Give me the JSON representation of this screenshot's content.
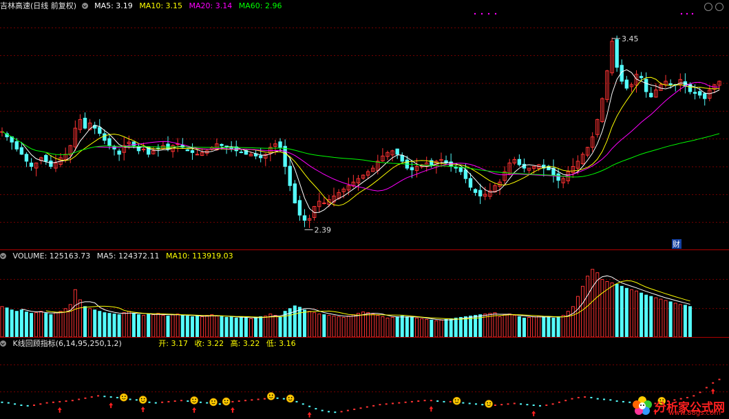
{
  "price_header": {
    "stock": "吉林高速(日线 前复权)",
    "ma5": "MA5: 3.19",
    "ma10": "MA10: 3.15",
    "ma20": "MA20: 3.14",
    "ma60": "MA60: 2.96"
  },
  "volume_header": {
    "volume": "VOLUME: 125163.73",
    "ma5": "MA5: 124372.11",
    "ma10": "MA10: 113919.03"
  },
  "indicator_header": {
    "name": "K线回顾指标(6,14,95,250,1,2)",
    "open": "开: 3.17",
    "close": "收: 3.22",
    "high": "高: 3.22",
    "low": "低: 3.16"
  },
  "price_annotations": {
    "high_label": "3.45",
    "low_label": "2.39",
    "fin_marker": "财"
  },
  "colors": {
    "up": "#ff3333",
    "down": "#54fcfc",
    "ma5": "#ffffff",
    "ma10": "#ffff00",
    "ma20": "#ff00ff",
    "ma60": "#00ff00",
    "grid": "#7a0000"
  },
  "watermark": {
    "text": "分析家公式网",
    "url": "www.88gs.com"
  },
  "chart_data": [
    {
      "type": "candlestick",
      "ylim": [
        2.3,
        3.6
      ],
      "ma_lines": [
        "MA5",
        "MA10",
        "MA20",
        "MA60"
      ],
      "closes": [
        2.93,
        2.9,
        2.87,
        2.83,
        2.8,
        2.76,
        2.73,
        2.75,
        2.78,
        2.76,
        2.73,
        2.75,
        2.78,
        2.8,
        2.85,
        2.95,
        3,
        2.95,
        2.98,
        2.95,
        2.92,
        2.88,
        2.85,
        2.83,
        2.8,
        2.85,
        2.87,
        2.85,
        2.82,
        2.83,
        2.8,
        2.82,
        2.83,
        2.85,
        2.83,
        2.85,
        2.86,
        2.84,
        2.82,
        2.81,
        2.8,
        2.81,
        2.82,
        2.84,
        2.86,
        2.85,
        2.84,
        2.83,
        2.82,
        2.81,
        2.8,
        2.8,
        2.79,
        2.78,
        2.8,
        2.84,
        2.86,
        2.84,
        2.73,
        2.62,
        2.52,
        2.45,
        2.42,
        2.43,
        2.5,
        2.53,
        2.52,
        2.54,
        2.56,
        2.58,
        2.6,
        2.62,
        2.64,
        2.66,
        2.68,
        2.7,
        2.72,
        2.76,
        2.79,
        2.81,
        2.82,
        2.8,
        2.76,
        2.72,
        2.71,
        2.73,
        2.74,
        2.75,
        2.74,
        2.76,
        2.77,
        2.75,
        2.73,
        2.72,
        2.7,
        2.66,
        2.61,
        2.58,
        2.56,
        2.57,
        2.59,
        2.62,
        2.64,
        2.7,
        2.75,
        2.77,
        2.74,
        2.72,
        2.72,
        2.73,
        2.74,
        2.72,
        2.71,
        2.68,
        2.65,
        2.66,
        2.7,
        2.73,
        2.76,
        2.8,
        2.84,
        2.9,
        3,
        3.12,
        3.28,
        3.45,
        3.3,
        3.22,
        3.18,
        3.2,
        3.26,
        3.24,
        3.16,
        3.13,
        3.17,
        3.2,
        3.22,
        3.2,
        3.2,
        3.23,
        3.19,
        3.16,
        3.15,
        3.14,
        3.12,
        3.17,
        3.2,
        3.22
      ],
      "volumes": [
        45,
        43,
        40,
        38,
        40,
        37,
        35,
        36,
        38,
        35,
        33,
        36,
        38,
        42,
        48,
        70,
        55,
        45,
        42,
        40,
        38,
        36,
        35,
        34,
        33,
        36,
        38,
        35,
        33,
        32,
        34,
        33,
        35,
        32,
        31,
        33,
        34,
        32,
        31,
        30,
        31,
        30,
        32,
        33,
        31,
        30,
        29,
        30,
        28,
        30,
        28,
        27,
        29,
        30,
        31,
        34,
        32,
        30,
        38,
        42,
        46,
        44,
        40,
        38,
        36,
        34,
        33,
        32,
        31,
        30,
        29,
        31,
        33,
        35,
        37,
        36,
        34,
        32,
        30,
        28,
        29,
        30,
        31,
        30,
        29,
        28,
        27,
        26,
        25,
        24,
        25,
        26,
        27,
        28,
        29,
        30,
        31,
        32,
        33,
        34,
        35,
        36,
        30,
        33,
        34,
        32,
        30,
        28,
        29,
        30,
        31,
        30,
        29,
        28,
        30,
        32,
        38,
        45,
        60,
        75,
        90,
        100,
        95,
        85,
        82,
        80,
        78,
        75,
        72,
        70,
        68,
        65,
        62,
        60,
        58,
        56,
        54,
        52,
        50,
        48,
        47,
        45
      ],
      "low_label_value": 2.39,
      "high_label_value": 3.45
    },
    {
      "type": "indicator-line",
      "ylim": [
        0,
        1
      ],
      "values": [
        0.25,
        0.24,
        0.22,
        0.2,
        0.19,
        0.2,
        0.22,
        0.24,
        0.25,
        0.26,
        0.27,
        0.28,
        0.3,
        0.32,
        0.34,
        0.36,
        0.35,
        0.34,
        0.33,
        0.31,
        0.3,
        0.29,
        0.27,
        0.25,
        0.24,
        0.25,
        0.26,
        0.27,
        0.28,
        0.27,
        0.26,
        0.25,
        0.24,
        0.23,
        0.22,
        0.24,
        0.26,
        0.27,
        0.28,
        0.29,
        0.3,
        0.31,
        0.33,
        0.32,
        0.31,
        0.29,
        0.26,
        0.22,
        0.18,
        0.14,
        0.11,
        0.09,
        0.08,
        0.09,
        0.11,
        0.13,
        0.15,
        0.17,
        0.19,
        0.21,
        0.22,
        0.23,
        0.24,
        0.25,
        0.26,
        0.27,
        0.28,
        0.28,
        0.27,
        0.26,
        0.26,
        0.25,
        0.24,
        0.23,
        0.22,
        0.21,
        0.2,
        0.2,
        0.21,
        0.22,
        0.23,
        0.22,
        0.21,
        0.2,
        0.19,
        0.2,
        0.22,
        0.25,
        0.28,
        0.31,
        0.33,
        0.34,
        0.33,
        0.31,
        0.3,
        0.29,
        0.27,
        0.26,
        0.25,
        0.24,
        0.23,
        0.22,
        0.23,
        0.25,
        0.27,
        0.29,
        0.31,
        0.33,
        0.36,
        0.42,
        0.5,
        0.58,
        0.64
      ]
    }
  ]
}
